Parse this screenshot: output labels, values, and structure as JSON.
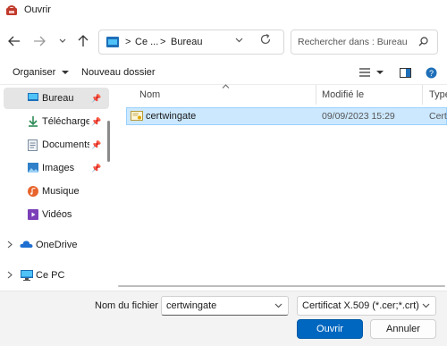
{
  "window": {
    "title": "Ouvrir",
    "icon": "dialog-app-icon"
  },
  "nav": {
    "back": "back-arrow-icon",
    "forward": "forward-arrow-icon",
    "recent": "chevron-down-icon",
    "up": "up-arrow-icon",
    "address": {
      "segments": [
        "Ce ...",
        "Bureau"
      ],
      "separator": ">"
    },
    "refresh": "refresh-icon",
    "search_placeholder": "Rechercher dans : Bureau"
  },
  "toolbar": {
    "organize_label": "Organiser",
    "new_folder_label": "Nouveau dossier",
    "view_icon": "list-view-icon",
    "preview_icon": "preview-pane-icon",
    "help_icon": "help-icon"
  },
  "sidebar": {
    "items": [
      {
        "label": "Bureau",
        "icon": "desktop-icon",
        "pinned": true,
        "selected": true
      },
      {
        "label": "Téléchargem",
        "icon": "download-icon",
        "pinned": true
      },
      {
        "label": "Documents",
        "icon": "documents-icon",
        "pinned": true
      },
      {
        "label": "Images",
        "icon": "images-icon",
        "pinned": true
      },
      {
        "label": "Musique",
        "icon": "music-icon",
        "pinned": false
      },
      {
        "label": "Vidéos",
        "icon": "videos-icon",
        "pinned": false
      },
      {
        "label": "OneDrive",
        "icon": "onedrive-icon",
        "expandable": true
      },
      {
        "label": "Ce PC",
        "icon": "computer-icon",
        "expandable": true
      }
    ]
  },
  "columns": [
    "Nom",
    "Modifié le",
    "Type"
  ],
  "files": [
    {
      "name": "certwingate",
      "modified": "09/09/2023 15:29",
      "type": "Certi"
    }
  ],
  "footer": {
    "filename_label": "Nom du fichier :",
    "filename_value": "certwingate",
    "filetype_value": "Certificat X.509 (*.cer;*.crt)",
    "open_label": "Ouvrir",
    "cancel_label": "Annuler"
  },
  "colors": {
    "accent": "#0067c0",
    "selection": "#cce8ff"
  }
}
